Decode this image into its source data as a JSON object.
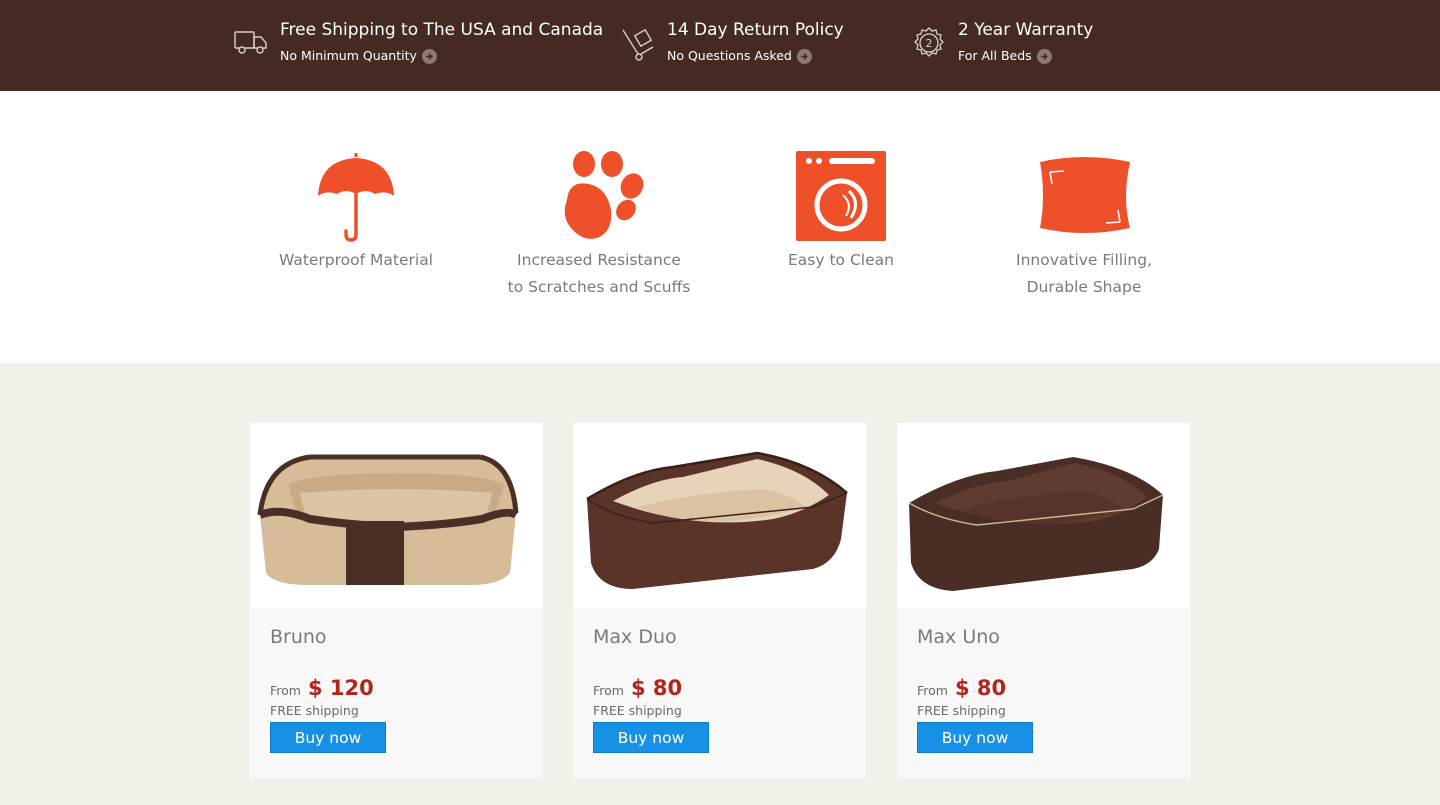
{
  "topbar": {
    "items": [
      {
        "icon": "truck-icon",
        "title": "Free Shipping to The USA and Canada",
        "sub": "No Minimum Quantity"
      },
      {
        "icon": "dolly-icon",
        "title": "14 Day Return Policy",
        "sub": "No Questions Asked"
      },
      {
        "icon": "warranty-seal-icon",
        "title": "2 Year Warranty",
        "sub": "For All Beds",
        "seal_number": "2"
      }
    ]
  },
  "features": [
    {
      "icon": "umbrella-icon",
      "line1": "Waterproof Material",
      "line2": ""
    },
    {
      "icon": "paw-icon",
      "line1": "Increased Resistance",
      "line2": "to Scratches and Scuffs"
    },
    {
      "icon": "washing-machine-icon",
      "line1": "Easy to Clean",
      "line2": ""
    },
    {
      "icon": "pillow-icon",
      "line1": "Innovative Filling,",
      "line2": "Durable Shape"
    }
  ],
  "products": [
    {
      "name": "Bruno",
      "from": "From",
      "price": "$ 120",
      "shipping": "FREE shipping",
      "button": "Buy now"
    },
    {
      "name": "Max Duo",
      "from": "From",
      "price": "$ 80",
      "shipping": "FREE shipping",
      "button": "Buy now"
    },
    {
      "name": "Max Uno",
      "from": "From",
      "price": "$ 80",
      "shipping": "FREE shipping",
      "button": "Buy now"
    }
  ],
  "colors": {
    "topbar_bg": "#452a24",
    "accent_orange": "#ee5029",
    "price_red": "#b5241b",
    "button_blue": "#1791e6",
    "products_bg": "#f3f0ea"
  }
}
